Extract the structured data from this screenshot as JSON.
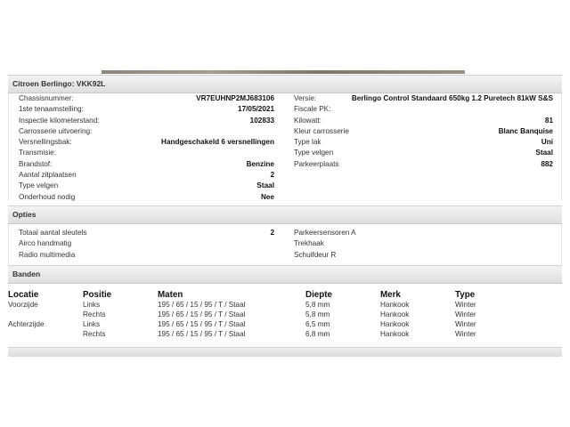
{
  "vehicle_section": {
    "title": "Citroen Berlingo: VKK92L",
    "left": [
      {
        "label": "Chassisnummer:",
        "value": "VR7EUHNP2MJ683106"
      },
      {
        "label": "1ste tenaamstelling:",
        "value": "17/05/2021"
      },
      {
        "label": "Inspectie kilometerstand:",
        "value": "102833"
      },
      {
        "label": "Carrosserie uitvoering:",
        "value": ""
      },
      {
        "label": "Versnellingsbak:",
        "value": "Handgeschakeld 6 versnellingen"
      },
      {
        "label": "Transmisie:",
        "value": ""
      },
      {
        "label": "Brandstof:",
        "value": "Benzine"
      },
      {
        "label": "Aantal zitplaatsen",
        "value": "2"
      },
      {
        "label": "Type velgen",
        "value": "Staal"
      },
      {
        "label": "Onderhoud nodig",
        "value": "Nee"
      }
    ],
    "right": [
      {
        "label": "Versie:",
        "value": "Berlingo Control Standaard 650kg 1.2 Puretech 81kW S&S"
      },
      {
        "label": "Fiscale PK:",
        "value": ""
      },
      {
        "label": "Kilowatt:",
        "value": "81"
      },
      {
        "label": "Kleur carrosserie",
        "value": "Blanc Banquise"
      },
      {
        "label": "Type lak",
        "value": "Uni"
      },
      {
        "label": "Type velgen",
        "value": "Staal"
      },
      {
        "label": "Parkeerplaats",
        "value": "882"
      }
    ]
  },
  "options_section": {
    "title": "Opties",
    "left": [
      {
        "label": "Totaal aantal sleutels",
        "value": "2"
      },
      {
        "label": "Airco handmatig",
        "value": ""
      },
      {
        "label": "Radio multimedia",
        "value": ""
      }
    ],
    "right": [
      {
        "label": "Parkeersensoren A",
        "value": ""
      },
      {
        "label": "Trekhaak",
        "value": ""
      },
      {
        "label": "Schuifdeur R",
        "value": ""
      }
    ]
  },
  "tires_section": {
    "title": "Banden",
    "headers": [
      "Locatie",
      "Positie",
      "Maten",
      "Diepte",
      "Merk",
      "Type"
    ],
    "rows": [
      [
        "Voorzijde",
        "Links",
        "195 / 65 / 15 / 95 / T / Staal",
        "5,8 mm",
        "Hankook",
        "Winter"
      ],
      [
        "",
        "Rechts",
        "195 / 65 / 15 / 95 / T / Staal",
        "5,8 mm",
        "Hankook",
        "Winter"
      ],
      [
        "Achterzijde",
        "Links",
        "195 / 65 / 15 / 95 / T / Staal",
        "6,5 mm",
        "Hankook",
        "Winter"
      ],
      [
        "",
        "Rechts",
        "195 / 65 / 15 / 95 / T / Staal",
        "6,8 mm",
        "Hankook",
        "Winter"
      ]
    ]
  }
}
